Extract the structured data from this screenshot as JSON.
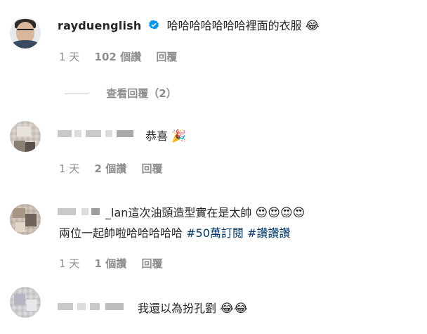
{
  "comments": [
    {
      "username": "rayduenglish",
      "text": "哈哈哈哈哈哈哈裡面的衣服",
      "emoji": "😂",
      "time": "1 天",
      "likes": "102 個讚",
      "reply": "回覆",
      "view_replies": "查看回覆（2）"
    },
    {
      "username": "",
      "text": "恭喜",
      "emoji": "🎉",
      "time": "1 天",
      "likes": "2 個讚",
      "reply": "回覆"
    },
    {
      "username": "",
      "line1_prefix": "_lan這次油頭造型實在是太帥",
      "line1_emoji": "😍😍😍😍",
      "line2_text": "兩位一起帥啦哈哈哈哈哈",
      "tags": [
        "#50萬訂閱",
        "#讚讚讚"
      ],
      "time": "1 天",
      "likes": "1 個讚",
      "reply": "回覆"
    },
    {
      "username": "",
      "text": "我還以為扮孔劉",
      "emoji": "😂😂"
    }
  ],
  "colors": {
    "primary_text": "#262626",
    "secondary_text": "#8e8e8e",
    "hashtag": "#00376b",
    "verified": "#0095f6"
  }
}
